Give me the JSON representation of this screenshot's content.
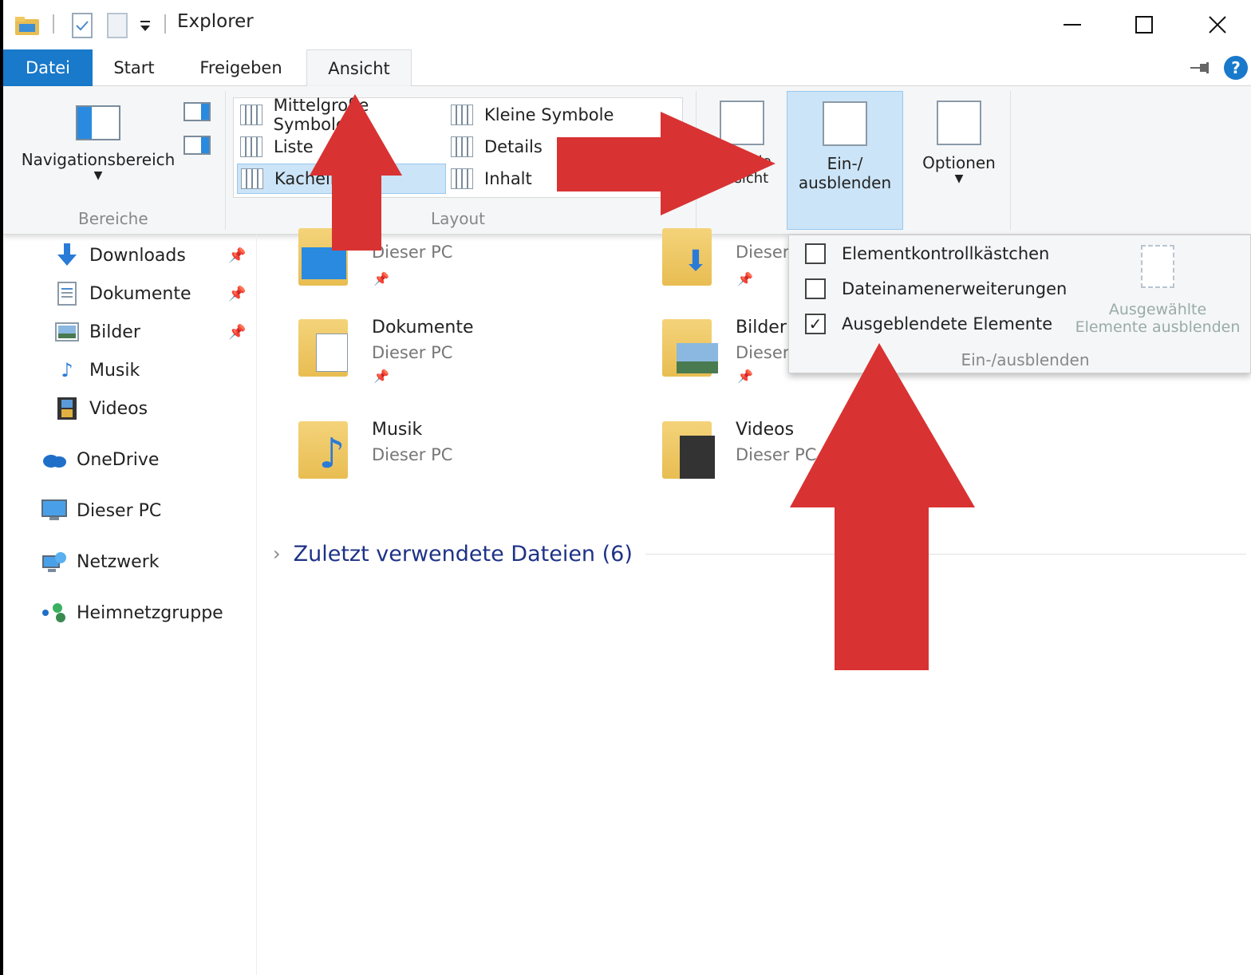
{
  "window": {
    "title": "Explorer"
  },
  "tabs": [
    {
      "label": "Datei"
    },
    {
      "label": "Start"
    },
    {
      "label": "Freigeben"
    },
    {
      "label": "Ansicht"
    }
  ],
  "ribbon": {
    "bereiche": {
      "nav_button_label": "Navigationsbereich",
      "group_label": "Bereiche"
    },
    "layout": {
      "group_label": "Layout",
      "items": [
        {
          "label": "Mittelgroße Symbole"
        },
        {
          "label": "Liste"
        },
        {
          "label": "Kacheln"
        },
        {
          "label": "Kleine Symbole"
        },
        {
          "label": "Details"
        },
        {
          "label": "Inhalt"
        }
      ],
      "selected": "Kacheln"
    },
    "view_button_label": "Aktuelle Ansicht",
    "toggle_button_label_line1": "Ein-/",
    "toggle_button_label_line2": "ausblenden",
    "options_button_label": "Optionen"
  },
  "dropdown": {
    "checkboxes": [
      {
        "label": "Elementkontrollkästchen",
        "checked": false,
        "mark": ""
      },
      {
        "label": "Dateinamenerweiterungen",
        "checked": false,
        "mark": ""
      },
      {
        "label": "Ausgeblendete Elemente",
        "checked": true,
        "mark": "✓"
      }
    ],
    "hide_selected_line1": "Ausgewählte",
    "hide_selected_line2": "Elemente ausblenden",
    "group_label": "Ein-/ausblenden"
  },
  "navpane": {
    "quick_access": [
      {
        "label": "Downloads",
        "icon": "download-arrow-icon",
        "pinned": true
      },
      {
        "label": "Dokumente",
        "icon": "document-icon",
        "pinned": true
      },
      {
        "label": "Bilder",
        "icon": "picture-icon",
        "pinned": true
      },
      {
        "label": "Musik",
        "icon": "music-note-icon",
        "pinned": false
      },
      {
        "label": "Videos",
        "icon": "film-icon",
        "pinned": false
      }
    ],
    "roots": [
      {
        "label": "OneDrive",
        "icon": "cloud-icon"
      },
      {
        "label": "Dieser PC",
        "icon": "monitor-icon"
      },
      {
        "label": "Netzwerk",
        "icon": "network-icon"
      },
      {
        "label": "Heimnetzgruppe",
        "icon": "homegroup-icon"
      }
    ]
  },
  "content": {
    "folders": [
      {
        "name": "",
        "location": "Dieser PC"
      },
      {
        "name": "",
        "location": "Dieser PC"
      },
      {
        "name": "Dokumente",
        "location": "Dieser PC"
      },
      {
        "name": "Bilder",
        "location": "Dieser PC"
      },
      {
        "name": "Musik",
        "location": "Dieser PC"
      },
      {
        "name": "Videos",
        "location": "Dieser PC"
      }
    ],
    "recent_label": "Zuletzt verwendete Dateien (6)"
  },
  "colors": {
    "accent": "#1979ca",
    "selection": "#cce4f7",
    "arrow_red": "#d93232",
    "heading_blue": "#1e3287"
  }
}
